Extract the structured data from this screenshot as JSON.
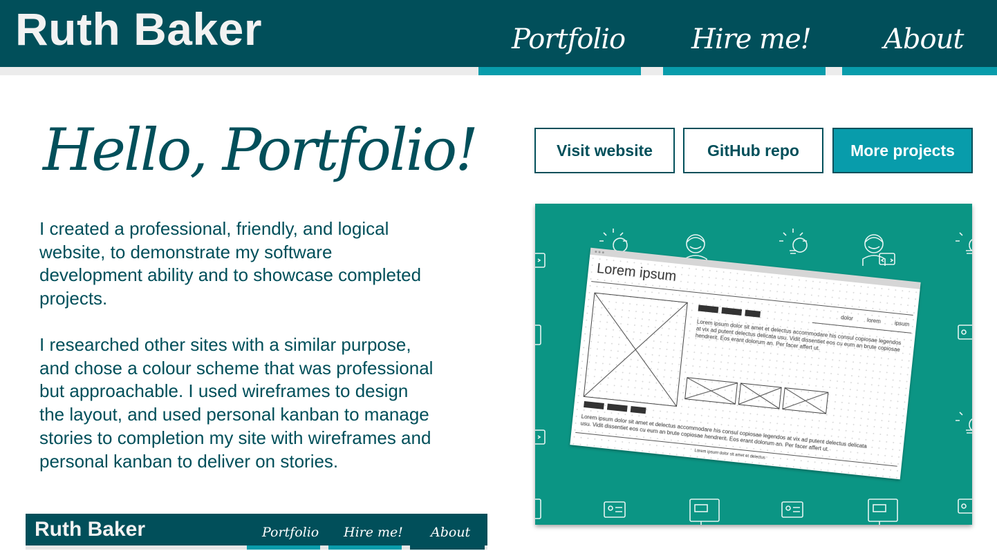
{
  "header": {
    "brand": "Ruth Baker",
    "nav": [
      "Portfolio",
      "Hire me!",
      "About"
    ]
  },
  "heading": "Hello, Portfolio!",
  "paragraphs": [
    "I created a professional, friendly, and logical\nwebsite, to demonstrate my software\ndevelopment ability and to showcase completed\nprojects.",
    "I researched other sites with a similar purpose,\nand chose a colour scheme that was professional\nbut approachable.  I used wireframes to design\nthe layout, and used personal kanban to manage\nstories to completion my site with wireframes and\npersonal kanban to deliver on stories."
  ],
  "buttons": {
    "visit": "Visit website",
    "github": "GitHub repo",
    "more": "More projects"
  },
  "wireframe": {
    "title": "Lorem ipsum",
    "tabs": [
      "dolor",
      "lorem",
      "ipsum"
    ],
    "body_text": "Lorem ipsum dolor sit amet et delectus accommodare his consul copiosae legendos at vix ad putent delectus delicata usu. Vidit dissentiet eos cu eum an brute copiosae hendrerit. Eos erant dolorum an. Per facer affert ut.",
    "footer_text": "Lorem ipsum dolor sit amet et delectus accommodare his consul copiosae legendos at vix ad putent delectus delicata usu. Vidit dissentiet eos cu eum an brute copiosae hendrerit. Eos erant dolorum an. Per facer affert ut.",
    "bottom_text": "Lorem ipsum dolor sit amet et delectus"
  },
  "mini_header": {
    "brand": "Ruth Baker",
    "nav": [
      "Portfolio",
      "Hire me!",
      "About"
    ]
  },
  "colors": {
    "dark_teal": "#014f5a",
    "accent_teal": "#089cab",
    "card_green": "#0b9584"
  }
}
